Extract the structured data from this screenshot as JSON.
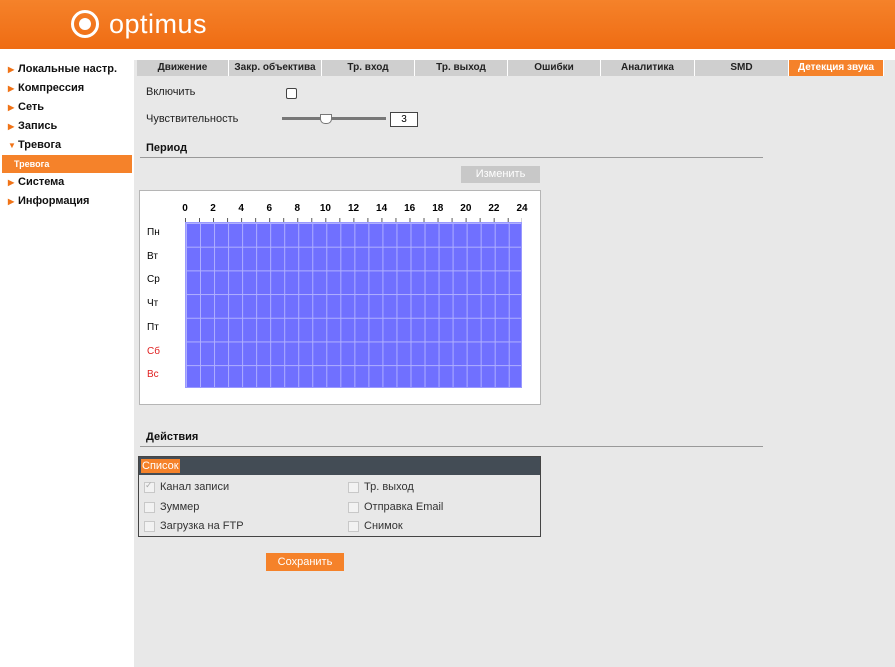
{
  "brand": {
    "name": "optimus"
  },
  "sidebar": {
    "items": [
      {
        "label": "Локальные настр.",
        "arrow": "▶"
      },
      {
        "label": "Компрессия",
        "arrow": "▶"
      },
      {
        "label": "Сеть",
        "arrow": "▶"
      },
      {
        "label": "Запись",
        "arrow": "▶"
      },
      {
        "label": "Тревога",
        "arrow": "▼"
      },
      {
        "label": "Система",
        "arrow": "▶"
      },
      {
        "label": "Информация",
        "arrow": "▶"
      }
    ],
    "sub_item": "Тревога"
  },
  "tabs": [
    {
      "label": "Движение"
    },
    {
      "label": "Закр. объектива"
    },
    {
      "label": "Тр. вход"
    },
    {
      "label": "Тр. выход"
    },
    {
      "label": "Ошибки"
    },
    {
      "label": "Аналитика"
    },
    {
      "label": "SMD"
    },
    {
      "label": "Детекция звука",
      "active": true
    }
  ],
  "form": {
    "enable_label": "Включить",
    "enable_checked": false,
    "sensitivity_label": "Чувствительность",
    "sensitivity_value": "3"
  },
  "period": {
    "title": "Период",
    "edit_button": "Изменить",
    "hours": [
      "0",
      "2",
      "4",
      "6",
      "8",
      "10",
      "12",
      "14",
      "16",
      "18",
      "20",
      "22",
      "24"
    ],
    "days": [
      {
        "label": "Пн",
        "weekend": false
      },
      {
        "label": "Вт",
        "weekend": false
      },
      {
        "label": "Ср",
        "weekend": false
      },
      {
        "label": "Чт",
        "weekend": false
      },
      {
        "label": "Пт",
        "weekend": false
      },
      {
        "label": "Сб",
        "weekend": true
      },
      {
        "label": "Вс",
        "weekend": true
      }
    ],
    "fill_color": "#7070ff"
  },
  "actions": {
    "title": "Действия",
    "list_header": "Список",
    "items": [
      {
        "label": "Канал записи",
        "checked": true
      },
      {
        "label": "Тр. выход",
        "checked": false
      },
      {
        "label": "Зуммер",
        "checked": false
      },
      {
        "label": "Отправка Email",
        "checked": false
      },
      {
        "label": "Загрузка на FTP",
        "checked": false
      },
      {
        "label": "Снимок",
        "checked": false
      }
    ]
  },
  "save_button": "Сохранить",
  "colors": {
    "accent": "#f5822a",
    "header_bar": "#434c55",
    "weekend": "#e02020"
  }
}
